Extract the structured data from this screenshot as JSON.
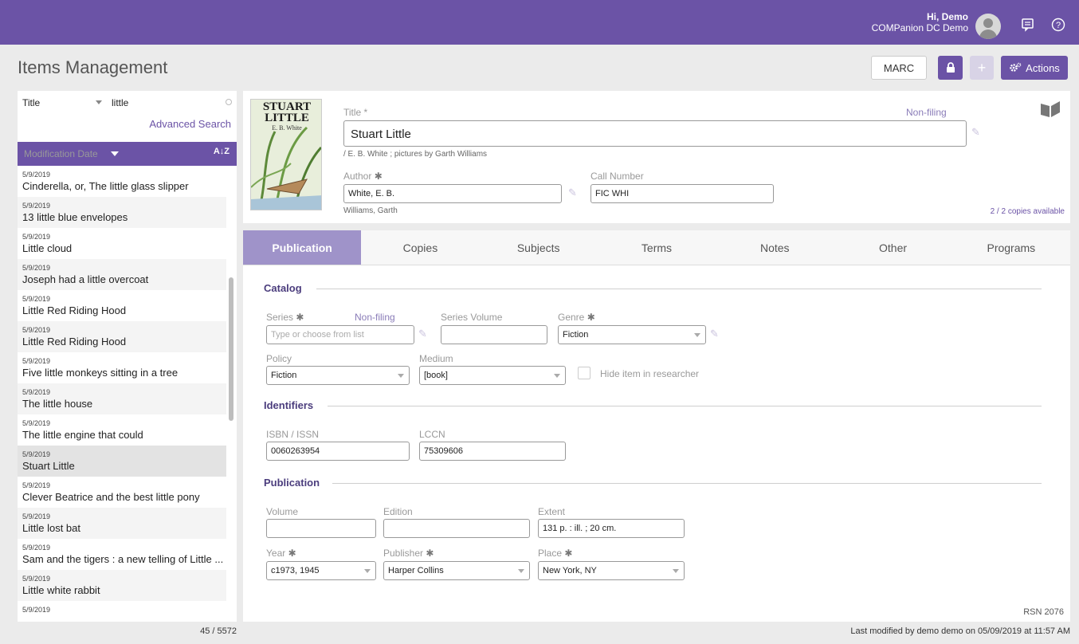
{
  "header": {
    "greeting": "Hi, Demo",
    "org": "COMPanion DC Demo",
    "icons": [
      "avatar",
      "messages-icon",
      "help-icon"
    ]
  },
  "page": {
    "title": "Items Management"
  },
  "toolbar": {
    "marc_label": "MARC",
    "actions_label": "Actions",
    "plus_label": "+"
  },
  "search": {
    "field": "Title",
    "query": "little",
    "advanced_label": "Advanced Search"
  },
  "sort": {
    "label": "Modification Date",
    "az_label": "A↓Z"
  },
  "results": [
    {
      "date": "5/9/2019",
      "title": "Cinderella, or, The little glass slipper"
    },
    {
      "date": "5/9/2019",
      "title": "13 little blue envelopes"
    },
    {
      "date": "5/9/2019",
      "title": "Little cloud"
    },
    {
      "date": "5/9/2019",
      "title": "Joseph had a little overcoat"
    },
    {
      "date": "5/9/2019",
      "title": "Little Red Riding Hood"
    },
    {
      "date": "5/9/2019",
      "title": "Little Red Riding Hood"
    },
    {
      "date": "5/9/2019",
      "title": "Five little monkeys sitting in a tree"
    },
    {
      "date": "5/9/2019",
      "title": "The little house"
    },
    {
      "date": "5/9/2019",
      "title": "The little engine that could"
    },
    {
      "date": "5/9/2019",
      "title": "Stuart Little",
      "selected": true
    },
    {
      "date": "5/9/2019",
      "title": "Clever Beatrice and the best little pony"
    },
    {
      "date": "5/9/2019",
      "title": "Little lost bat"
    },
    {
      "date": "5/9/2019",
      "title": "Sam and the tigers : a new telling of Little ..."
    },
    {
      "date": "5/9/2019",
      "title": "Little white rabbit"
    },
    {
      "date": "5/9/2019",
      "title": ""
    }
  ],
  "results_count": "45 / 5572",
  "item": {
    "cover_title": "STUART LITTLE",
    "cover_author": "E. B. White",
    "title_label": "Title *",
    "title_value": "Stuart Little",
    "nonfiling_label": "Non-filing",
    "responsibility": "/ E. B. White ; pictures by Garth Williams",
    "author_label": "Author",
    "author_value": "White, E. B.",
    "author_secondary": "Williams, Garth",
    "callnumber_label": "Call Number",
    "callnumber_value": "FIC WHI",
    "copies_available": "2 / 2 copies available"
  },
  "tabs": [
    "Publication",
    "Copies",
    "Subjects",
    "Terms",
    "Notes",
    "Other",
    "Programs"
  ],
  "catalog": {
    "heading": "Catalog",
    "series_label": "Series",
    "series_nonfiling": "Non-filing",
    "series_placeholder": "Type or choose from list",
    "series_volume_label": "Series Volume",
    "genre_label": "Genre",
    "genre_value": "Fiction",
    "policy_label": "Policy",
    "policy_value": "Fiction",
    "medium_label": "Medium",
    "medium_value": "[book]",
    "hide_label": "Hide item in researcher"
  },
  "identifiers": {
    "heading": "Identifiers",
    "isbn_label": "ISBN / ISSN",
    "isbn_value": "0060263954",
    "lccn_label": "LCCN",
    "lccn_value": "75309606"
  },
  "publication": {
    "heading": "Publication",
    "volume_label": "Volume",
    "edition_label": "Edition",
    "extent_label": "Extent",
    "extent_value": "131 p. : ill. ; 20 cm.",
    "year_label": "Year",
    "year_value": "c1973, 1945",
    "publisher_label": "Publisher",
    "publisher_value": "Harper Collins",
    "place_label": "Place",
    "place_value": "New York, NY"
  },
  "rsn": "RSN 2076",
  "last_modified": "Last modified by demo demo on 05/09/2019 at 11:57 AM",
  "colors": {
    "brand": "#6b53a6",
    "tab_active": "#9f93c9"
  }
}
